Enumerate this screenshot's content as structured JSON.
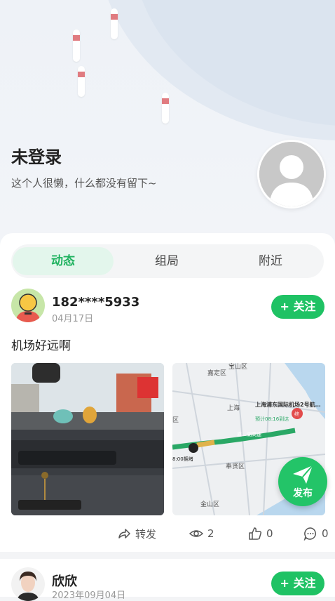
{
  "profile": {
    "name": "未登录",
    "bio": "这个人很懒，什么都没有留下~"
  },
  "tabs": [
    {
      "label": "动态",
      "active": true
    },
    {
      "label": "组局",
      "active": false
    },
    {
      "label": "附近",
      "active": false
    }
  ],
  "posts": [
    {
      "username": "182****5933",
      "date": "04月17日",
      "follow_label": "+ 关注",
      "text": "机场好远啊",
      "images": [
        "car-interior-photo",
        "map-route-screenshot"
      ],
      "map_labels": {
        "jiading": "嘉定区",
        "baoshan": "宝山区",
        "shanghai": "上海",
        "airport": "上海浦东国际机场2号航…",
        "eta": "预计08:16到达",
        "district": "区",
        "fengxian": "奉贤区",
        "jinshan": "金山区",
        "start_time": "8:00拥堵",
        "road": "嘉…湖高速",
        "end_badge": "终"
      },
      "actions": {
        "share": "转发",
        "views": "2",
        "likes": "0",
        "comments": "0"
      }
    },
    {
      "username": "欣欣",
      "date": "2023年09月04日",
      "follow_label": "+ 关注"
    }
  ],
  "fab": {
    "label": "发布"
  },
  "colors": {
    "accent": "#1fc264",
    "tab_active_bg": "#e3f6ec"
  }
}
